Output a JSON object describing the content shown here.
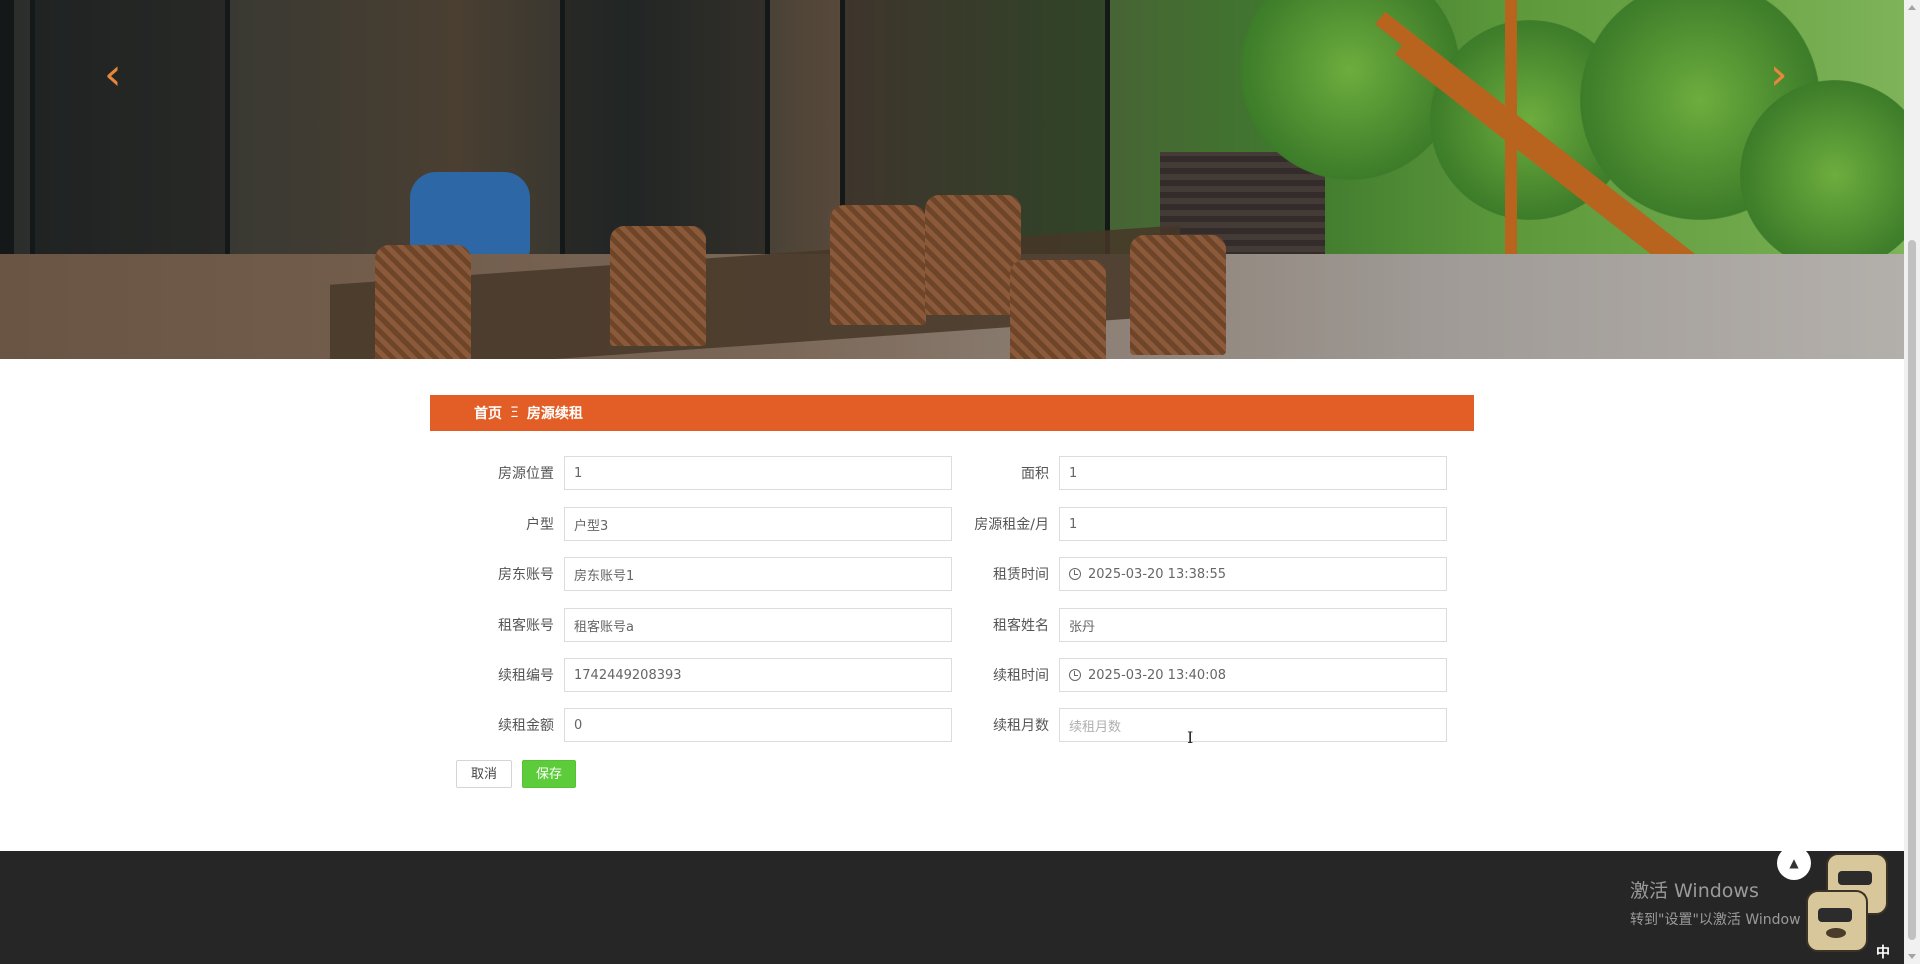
{
  "breadcrumb": {
    "home": "首页",
    "separator": "Ξ",
    "current": "房源续租"
  },
  "form": {
    "fields": [
      {
        "label": "房源位置",
        "value": "1"
      },
      {
        "label": "面积",
        "value": "1"
      },
      {
        "label": "户型",
        "value": "户型3"
      },
      {
        "label": "房源租金/月",
        "value": "1"
      },
      {
        "label": "房东账号",
        "value": "房东账号1"
      },
      {
        "label": "租赁时间",
        "value": "2025-03-20 13:38:55",
        "icon": "clock-icon"
      },
      {
        "label": "租客账号",
        "value": "租客账号a"
      },
      {
        "label": "租客姓名",
        "value": "张丹"
      },
      {
        "label": "续租编号",
        "value": "1742449208393"
      },
      {
        "label": "续租时间",
        "value": "2025-03-20 13:40:08",
        "icon": "clock-icon"
      },
      {
        "label": "续租金额",
        "value": "0"
      },
      {
        "label": "续租月数",
        "value": "",
        "placeholder": "续租月数"
      }
    ]
  },
  "buttons": {
    "cancel": "取消",
    "save": "保存"
  },
  "banner": {
    "prev_arrow": "‹",
    "next_arrow": "›"
  },
  "watermark": {
    "line1": "激活 Windows",
    "line2": "转到\"设置\"以激活 Windows。"
  },
  "back_to_top": "▲",
  "tray_text": "中",
  "colors": {
    "accent": "#e25e26",
    "save_button": "#5ccc3b",
    "footer": "#262626"
  }
}
